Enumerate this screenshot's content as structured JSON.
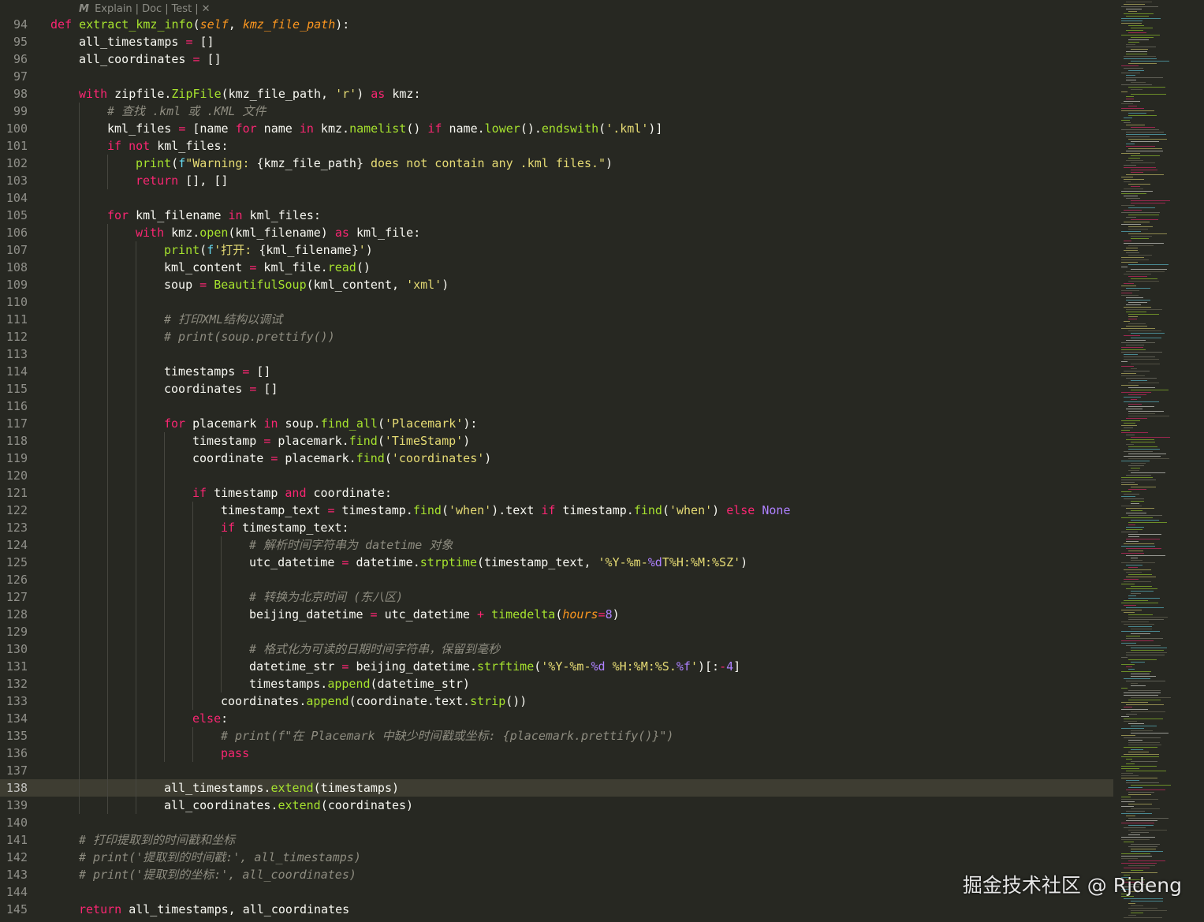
{
  "codelens": {
    "items": [
      "Explain",
      "Doc",
      "Test"
    ],
    "close_glyph": "✕"
  },
  "watermark": "掘金技术社区 @ Rjdeng",
  "active_line": 138,
  "lines": [
    {
      "n": 94,
      "ind": 0,
      "toks": [
        [
          "kw",
          "def "
        ],
        [
          "fn",
          "extract_kmz_info"
        ],
        [
          "",
          "("
        ],
        [
          "pm",
          "self"
        ],
        [
          "",
          ", "
        ],
        [
          "pm",
          "kmz_file_path"
        ],
        [
          "",
          "):"
        ]
      ]
    },
    {
      "n": 95,
      "ind": 1,
      "toks": [
        [
          "",
          "all_timestamps "
        ],
        [
          "op",
          "="
        ],
        [
          "",
          " []"
        ]
      ]
    },
    {
      "n": 96,
      "ind": 1,
      "toks": [
        [
          "",
          "all_coordinates "
        ],
        [
          "op",
          "="
        ],
        [
          "",
          " []"
        ]
      ]
    },
    {
      "n": 97,
      "ind": 1,
      "gapafter": 0,
      "toks": []
    },
    {
      "n": 98,
      "ind": 1,
      "toks": [
        [
          "kw",
          "with"
        ],
        [
          "",
          " zipfile."
        ],
        [
          "fn",
          "ZipFile"
        ],
        [
          "",
          "(kmz_file_path, "
        ],
        [
          "st",
          "'r'"
        ],
        [
          "",
          ") "
        ],
        [
          "kw",
          "as"
        ],
        [
          "",
          " kmz:"
        ]
      ]
    },
    {
      "n": 99,
      "ind": 2,
      "toks": [
        [
          "cm",
          "# 查找 .kml 或 .KML 文件"
        ]
      ]
    },
    {
      "n": 100,
      "ind": 2,
      "toks": [
        [
          "",
          "kml_files "
        ],
        [
          "op",
          "="
        ],
        [
          "",
          " [name "
        ],
        [
          "kw",
          "for"
        ],
        [
          "",
          " name "
        ],
        [
          "kw",
          "in"
        ],
        [
          "",
          " kmz."
        ],
        [
          "fn",
          "namelist"
        ],
        [
          "",
          "() "
        ],
        [
          "kw",
          "if"
        ],
        [
          "",
          " name."
        ],
        [
          "fn",
          "lower"
        ],
        [
          "",
          "()."
        ],
        [
          "fn",
          "endswith"
        ],
        [
          "",
          "("
        ],
        [
          "st",
          "'.kml'"
        ],
        [
          "",
          ")]"
        ]
      ]
    },
    {
      "n": 101,
      "ind": 2,
      "toks": [
        [
          "kw",
          "if"
        ],
        [
          "",
          " "
        ],
        [
          "kw",
          "not"
        ],
        [
          "",
          " kml_files:"
        ]
      ]
    },
    {
      "n": 102,
      "ind": 3,
      "toks": [
        [
          "fn",
          "print"
        ],
        [
          "",
          "("
        ],
        [
          "fp",
          "f"
        ],
        [
          "st",
          "\"Warning: "
        ],
        [
          "",
          "{kmz_file_path}"
        ],
        [
          "st",
          " does not contain any .kml files.\""
        ],
        [
          "",
          ")"
        ]
      ]
    },
    {
      "n": 103,
      "ind": 3,
      "toks": [
        [
          "kw",
          "return"
        ],
        [
          "",
          " [], []"
        ]
      ]
    },
    {
      "n": 104,
      "ind": 2,
      "toks": []
    },
    {
      "n": 105,
      "ind": 2,
      "toks": [
        [
          "kw",
          "for"
        ],
        [
          "",
          " kml_filename "
        ],
        [
          "kw",
          "in"
        ],
        [
          "",
          " kml_files:"
        ]
      ]
    },
    {
      "n": 106,
      "ind": 3,
      "toks": [
        [
          "kw",
          "with"
        ],
        [
          "",
          " kmz."
        ],
        [
          "fn",
          "open"
        ],
        [
          "",
          "(kml_filename) "
        ],
        [
          "kw",
          "as"
        ],
        [
          "",
          " kml_file:"
        ]
      ]
    },
    {
      "n": 107,
      "ind": 4,
      "toks": [
        [
          "fn",
          "print"
        ],
        [
          "",
          "("
        ],
        [
          "fp",
          "f"
        ],
        [
          "st",
          "'打开: "
        ],
        [
          "",
          "{kml_filename}"
        ],
        [
          "st",
          "'"
        ],
        [
          "",
          ")"
        ]
      ]
    },
    {
      "n": 108,
      "ind": 4,
      "toks": [
        [
          "",
          "kml_content "
        ],
        [
          "op",
          "="
        ],
        [
          "",
          " kml_file."
        ],
        [
          "fn",
          "read"
        ],
        [
          "",
          "()"
        ]
      ]
    },
    {
      "n": 109,
      "ind": 4,
      "toks": [
        [
          "",
          "soup "
        ],
        [
          "op",
          "="
        ],
        [
          "",
          " "
        ],
        [
          "cls",
          "BeautifulSoup"
        ],
        [
          "",
          "(kml_content, "
        ],
        [
          "st",
          "'xml'"
        ],
        [
          "",
          ")"
        ]
      ]
    },
    {
      "n": 110,
      "ind": 4,
      "toks": []
    },
    {
      "n": 111,
      "ind": 4,
      "toks": [
        [
          "cm",
          "# 打印XML结构以调试"
        ]
      ]
    },
    {
      "n": 112,
      "ind": 4,
      "toks": [
        [
          "cm",
          "# print(soup.prettify())"
        ]
      ]
    },
    {
      "n": 113,
      "ind": 4,
      "toks": []
    },
    {
      "n": 114,
      "ind": 4,
      "toks": [
        [
          "",
          "timestamps "
        ],
        [
          "op",
          "="
        ],
        [
          "",
          " []"
        ]
      ]
    },
    {
      "n": 115,
      "ind": 4,
      "toks": [
        [
          "",
          "coordinates "
        ],
        [
          "op",
          "="
        ],
        [
          "",
          " []"
        ]
      ]
    },
    {
      "n": 116,
      "ind": 4,
      "toks": []
    },
    {
      "n": 117,
      "ind": 4,
      "toks": [
        [
          "kw",
          "for"
        ],
        [
          "",
          " placemark "
        ],
        [
          "kw",
          "in"
        ],
        [
          "",
          " soup."
        ],
        [
          "fn",
          "find_all"
        ],
        [
          "",
          "("
        ],
        [
          "st",
          "'Placemark'"
        ],
        [
          "",
          "):"
        ]
      ]
    },
    {
      "n": 118,
      "ind": 5,
      "toks": [
        [
          "",
          "timestamp "
        ],
        [
          "op",
          "="
        ],
        [
          "",
          " placemark."
        ],
        [
          "fn",
          "find"
        ],
        [
          "",
          "("
        ],
        [
          "st",
          "'TimeStamp'"
        ],
        [
          "",
          ")"
        ]
      ]
    },
    {
      "n": 119,
      "ind": 5,
      "toks": [
        [
          "",
          "coordinate "
        ],
        [
          "op",
          "="
        ],
        [
          "",
          " placemark."
        ],
        [
          "fn",
          "find"
        ],
        [
          "",
          "("
        ],
        [
          "st",
          "'coordinates'"
        ],
        [
          "",
          ")"
        ]
      ]
    },
    {
      "n": 120,
      "ind": 5,
      "toks": []
    },
    {
      "n": 121,
      "ind": 5,
      "toks": [
        [
          "kw",
          "if"
        ],
        [
          "",
          " timestamp "
        ],
        [
          "kw",
          "and"
        ],
        [
          "",
          " coordinate:"
        ]
      ]
    },
    {
      "n": 122,
      "ind": 6,
      "toks": [
        [
          "",
          "timestamp_text "
        ],
        [
          "op",
          "="
        ],
        [
          "",
          " timestamp."
        ],
        [
          "fn",
          "find"
        ],
        [
          "",
          "("
        ],
        [
          "st",
          "'when'"
        ],
        [
          "",
          ").text "
        ],
        [
          "kw",
          "if"
        ],
        [
          "",
          " timestamp."
        ],
        [
          "fn",
          "find"
        ],
        [
          "",
          "("
        ],
        [
          "st",
          "'when'"
        ],
        [
          "",
          ") "
        ],
        [
          "kw",
          "else"
        ],
        [
          "",
          " "
        ],
        [
          "cn",
          "None"
        ]
      ]
    },
    {
      "n": 123,
      "ind": 6,
      "toks": [
        [
          "kw",
          "if"
        ],
        [
          "",
          " timestamp_text:"
        ]
      ]
    },
    {
      "n": 124,
      "ind": 7,
      "toks": [
        [
          "cm",
          "# 解析时间字符串为 datetime 对象"
        ]
      ]
    },
    {
      "n": 125,
      "ind": 7,
      "toks": [
        [
          "",
          "utc_datetime "
        ],
        [
          "op",
          "="
        ],
        [
          "",
          " datetime."
        ],
        [
          "fn",
          "strptime"
        ],
        [
          "",
          "(timestamp_text, "
        ],
        [
          "st",
          "'%Y-%m-"
        ],
        [
          "nu",
          "%d"
        ],
        [
          "st",
          "T%H:%M:%SZ'"
        ],
        [
          "",
          ")"
        ]
      ]
    },
    {
      "n": 126,
      "ind": 7,
      "toks": []
    },
    {
      "n": 127,
      "ind": 7,
      "toks": [
        [
          "cm",
          "# 转换为北京时间 (东八区)"
        ]
      ]
    },
    {
      "n": 128,
      "ind": 7,
      "toks": [
        [
          "",
          "beijing_datetime "
        ],
        [
          "op",
          "="
        ],
        [
          "",
          " utc_datetime "
        ],
        [
          "op",
          "+"
        ],
        [
          "",
          " "
        ],
        [
          "fn",
          "timedelta"
        ],
        [
          "",
          "("
        ],
        [
          "pm",
          "hours"
        ],
        [
          "op",
          "="
        ],
        [
          "nu",
          "8"
        ],
        [
          "",
          ")"
        ]
      ]
    },
    {
      "n": 129,
      "ind": 7,
      "toks": []
    },
    {
      "n": 130,
      "ind": 7,
      "toks": [
        [
          "cm",
          "# 格式化为可读的日期时间字符串，保留到毫秒"
        ]
      ]
    },
    {
      "n": 131,
      "ind": 7,
      "toks": [
        [
          "",
          "datetime_str "
        ],
        [
          "op",
          "="
        ],
        [
          "",
          " beijing_datetime."
        ],
        [
          "fn",
          "strftime"
        ],
        [
          "",
          "("
        ],
        [
          "st",
          "'%Y-%m-"
        ],
        [
          "nu",
          "%d"
        ],
        [
          "st",
          " %H:%M:%S."
        ],
        [
          "nu",
          "%f"
        ],
        [
          "st",
          "'"
        ],
        [
          "",
          ")[:"
        ],
        [
          "op",
          "-"
        ],
        [
          "nu",
          "4"
        ],
        [
          "",
          "]"
        ]
      ]
    },
    {
      "n": 132,
      "ind": 7,
      "toks": [
        [
          "",
          "timestamps."
        ],
        [
          "fn",
          "append"
        ],
        [
          "",
          "(datetime_str)"
        ]
      ]
    },
    {
      "n": 133,
      "ind": 6,
      "toks": [
        [
          "",
          "coordinates."
        ],
        [
          "fn",
          "append"
        ],
        [
          "",
          "(coordinate.text."
        ],
        [
          "fn",
          "strip"
        ],
        [
          "",
          "())"
        ]
      ]
    },
    {
      "n": 134,
      "ind": 5,
      "toks": [
        [
          "kw",
          "else"
        ],
        [
          "",
          ":"
        ]
      ]
    },
    {
      "n": 135,
      "ind": 6,
      "toks": [
        [
          "cm",
          "# print(f\"在 Placemark 中缺少时间戳或坐标: {placemark.prettify()}\")"
        ]
      ]
    },
    {
      "n": 136,
      "ind": 6,
      "toks": [
        [
          "kw",
          "pass"
        ]
      ]
    },
    {
      "n": 137,
      "ind": 4,
      "toks": []
    },
    {
      "n": 138,
      "ind": 4,
      "toks": [
        [
          "",
          "all_timestamps."
        ],
        [
          "fn",
          "extend"
        ],
        [
          "",
          "(timestamps)"
        ]
      ]
    },
    {
      "n": 139,
      "ind": 4,
      "toks": [
        [
          "",
          "all_coordinates."
        ],
        [
          "fn",
          "extend"
        ],
        [
          "",
          "(coordinates)"
        ]
      ]
    },
    {
      "n": 140,
      "ind": 1,
      "toks": []
    },
    {
      "n": 141,
      "ind": 1,
      "toks": [
        [
          "cm",
          "# 打印提取到的时间戳和坐标"
        ]
      ]
    },
    {
      "n": 142,
      "ind": 1,
      "toks": [
        [
          "cm",
          "# print('提取到的时间戳:', all_timestamps)"
        ]
      ]
    },
    {
      "n": 143,
      "ind": 1,
      "toks": [
        [
          "cm",
          "# print('提取到的坐标:', all_coordinates)"
        ]
      ]
    },
    {
      "n": 144,
      "ind": 1,
      "toks": []
    },
    {
      "n": 145,
      "ind": 1,
      "toks": [
        [
          "kw",
          "return"
        ],
        [
          "",
          " all_timestamps, all_coordinates"
        ]
      ]
    }
  ],
  "colors": {
    "background": "#272822",
    "keyword": "#f92672",
    "function": "#a6e22e",
    "string": "#e6db74",
    "comment": "#8e8c80",
    "parameter": "#fd971f",
    "number": "#ae81ff",
    "current_line": "#3e3d32"
  }
}
